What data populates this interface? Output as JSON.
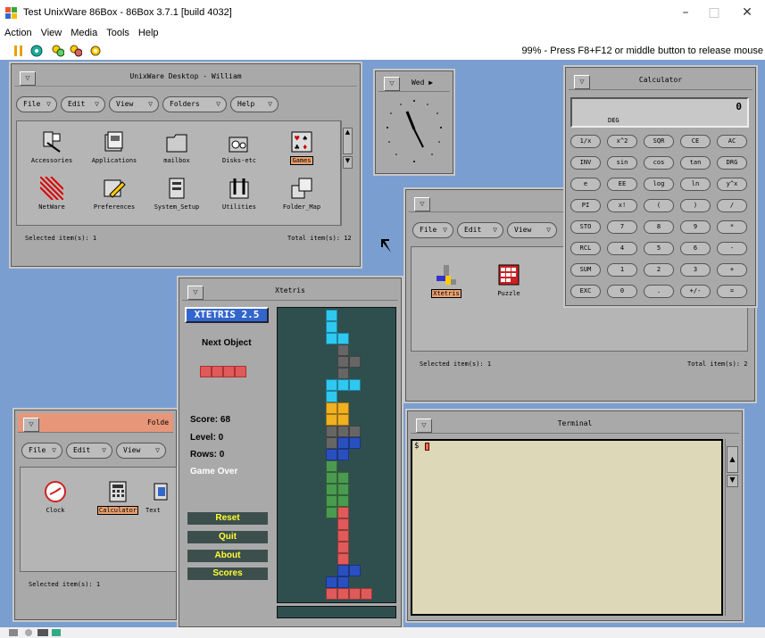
{
  "host": {
    "window_title": "Test UnixWare 86Box - 86Box 3.7.1 [build 4032]",
    "menu": [
      "Action",
      "View",
      "Media",
      "Tools",
      "Help"
    ],
    "status": "99% - Press F8+F12 or middle button to release mouse",
    "controls": {
      "minimize": "–",
      "maximize": "□",
      "close": "✕"
    }
  },
  "desktop_window": {
    "title": "UnixWare Desktop - William",
    "menus": [
      "File",
      "Edit",
      "View",
      "Folders",
      "Help"
    ],
    "icons": [
      "Accessories",
      "Applications",
      "mailbox",
      "Disks-etc",
      "Games",
      "NetWare",
      "Preferences",
      "System_Setup",
      "Utilities",
      "Folder_Map"
    ],
    "selected_icon": "Games",
    "footer_left": "Selected item(s): 1",
    "footer_right": "Total item(s): 12"
  },
  "clock_window": {
    "title": "Wed"
  },
  "calculator": {
    "title": "Calculator",
    "display_value": "0",
    "mode": "DEG",
    "buttons": [
      [
        "1/x",
        "x^2",
        "SQR",
        "CE",
        "AC"
      ],
      [
        "INV",
        "sin",
        "cos",
        "tan",
        "DRG"
      ],
      [
        "e",
        "EE",
        "log",
        "ln",
        "y^x"
      ],
      [
        "PI",
        "x!",
        "(",
        ")",
        "/"
      ],
      [
        "STO",
        "7",
        "8",
        "9",
        "*"
      ],
      [
        "RCL",
        "4",
        "5",
        "6",
        "-"
      ],
      [
        "SUM",
        "1",
        "2",
        "3",
        "+"
      ],
      [
        "EXC",
        "0",
        ".",
        "+/-",
        "="
      ]
    ]
  },
  "games_folder": {
    "title": "Fo",
    "menus": [
      "File",
      "Edit",
      "View"
    ],
    "icons": [
      "Xtetris",
      "Puzzle"
    ],
    "footer_left": "Selected item(s): 1",
    "footer_right": "Total item(s): 2"
  },
  "xtetris": {
    "title": "Xtetris",
    "logo": "XTETRIS 2.5",
    "next_label": "Next Object",
    "score": "Score: 68",
    "level": "Level: 0",
    "rows": "Rows: 0",
    "status": "Game Over",
    "buttons": [
      "Reset",
      "Quit",
      "About",
      "Scores"
    ]
  },
  "apps_folder": {
    "title": "Folde",
    "menus": [
      "File",
      "Edit",
      "View"
    ],
    "icons": [
      "Clock",
      "Calculator",
      "Text"
    ],
    "selected_icon": "Calculator",
    "footer_left": "Selected item(s): 1"
  },
  "terminal": {
    "title": "Terminal",
    "prompt": "$"
  },
  "colors": {
    "desktop": "#7b9ed0",
    "window": "#a9a9a9",
    "tetris_board": "#2f4f4f",
    "terminal_bg": "#dcd8b8",
    "active_title": "#e8967a"
  }
}
